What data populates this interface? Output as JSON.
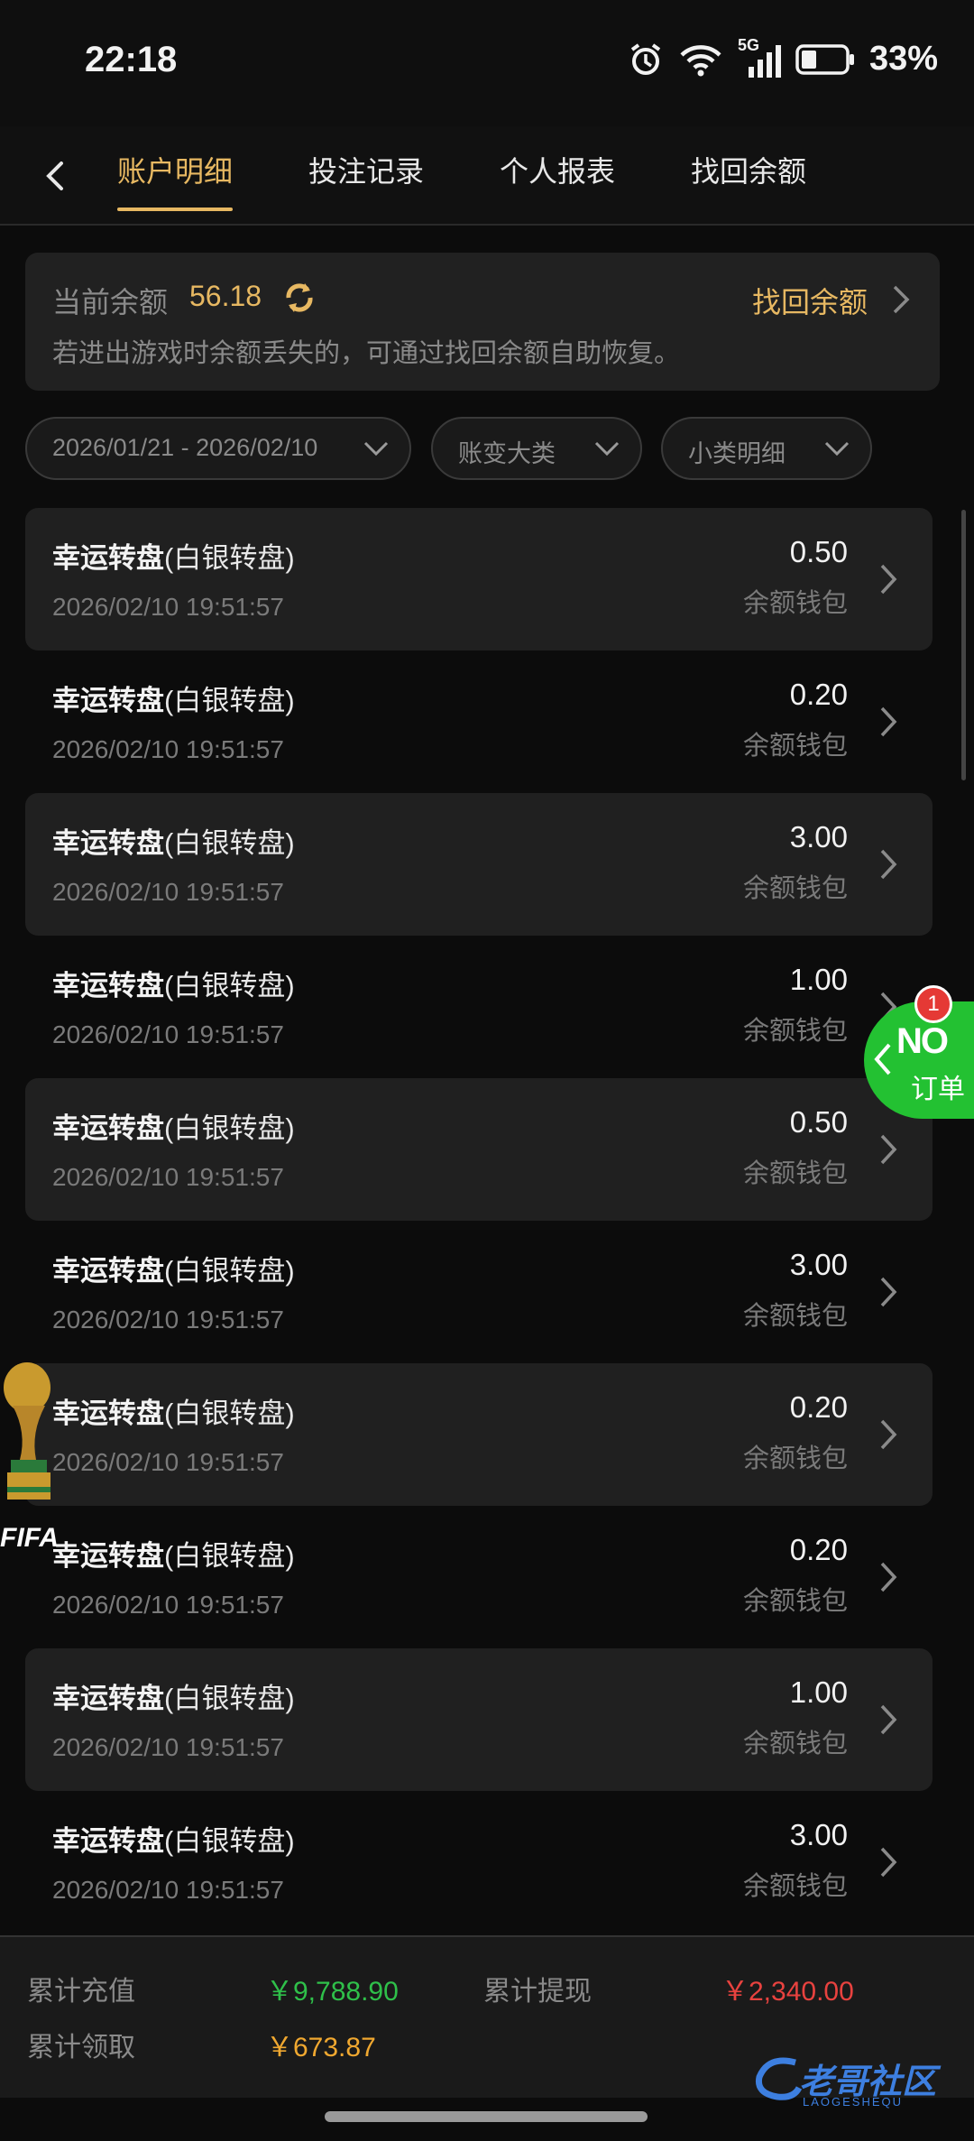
{
  "status_bar": {
    "time": "22:18",
    "network": "5G",
    "battery": "33%"
  },
  "nav": {
    "tabs": [
      {
        "label": "账户明细",
        "active": true
      },
      {
        "label": "投注记录"
      },
      {
        "label": "个人报表"
      },
      {
        "label": "找回余额"
      }
    ]
  },
  "balance": {
    "label": "当前余额",
    "value": "56.18",
    "recover_label": "找回余额",
    "hint": "若进出游戏时余额丢失的，可通过找回余额自助恢复。"
  },
  "filters": {
    "date_range": "2026/01/21 - 2026/02/10",
    "category": "账变大类",
    "subcategory": "小类明细"
  },
  "records": [
    {
      "title": "幸运转盘",
      "sub": "(白银转盘)",
      "time": "2026/02/10 19:51:57",
      "amount": "0.50",
      "wallet": "余额钱包"
    },
    {
      "title": "幸运转盘",
      "sub": "(白银转盘)",
      "time": "2026/02/10 19:51:57",
      "amount": "0.20",
      "wallet": "余额钱包"
    },
    {
      "title": "幸运转盘",
      "sub": "(白银转盘)",
      "time": "2026/02/10 19:51:57",
      "amount": "3.00",
      "wallet": "余额钱包"
    },
    {
      "title": "幸运转盘",
      "sub": "(白银转盘)",
      "time": "2026/02/10 19:51:57",
      "amount": "1.00",
      "wallet": "余额钱包"
    },
    {
      "title": "幸运转盘",
      "sub": "(白银转盘)",
      "time": "2026/02/10 19:51:57",
      "amount": "0.50",
      "wallet": "余额钱包"
    },
    {
      "title": "幸运转盘",
      "sub": "(白银转盘)",
      "time": "2026/02/10 19:51:57",
      "amount": "3.00",
      "wallet": "余额钱包"
    },
    {
      "title": "幸运转盘",
      "sub": "(白银转盘)",
      "time": "2026/02/10 19:51:57",
      "amount": "0.20",
      "wallet": "余额钱包"
    },
    {
      "title": "幸运转盘",
      "sub": "(白银转盘)",
      "time": "2026/02/10 19:51:57",
      "amount": "0.20",
      "wallet": "余额钱包"
    },
    {
      "title": "幸运转盘",
      "sub": "(白银转盘)",
      "time": "2026/02/10 19:51:57",
      "amount": "1.00",
      "wallet": "余额钱包"
    },
    {
      "title": "幸运转盘",
      "sub": "(白银转盘)",
      "time": "2026/02/10 19:51:57",
      "amount": "3.00",
      "wallet": "余额钱包"
    }
  ],
  "summary": {
    "deposit_label": "累计充值",
    "deposit_value": "￥9,788.90",
    "withdraw_label": "累计提现",
    "withdraw_value": "￥2,340.00",
    "claim_label": "累计领取",
    "claim_value": "￥673.87"
  },
  "float_order": {
    "badge": "1",
    "logo": "NO",
    "label": "订单"
  },
  "trophy": {
    "label": "FIFA"
  },
  "watermark": {
    "text": "老哥社区",
    "sub": "LAOGESHEQU"
  },
  "colors": {
    "gold": "#e7b862",
    "green": "#2fc04a",
    "red": "#e8423f",
    "orange": "#f0a830"
  }
}
